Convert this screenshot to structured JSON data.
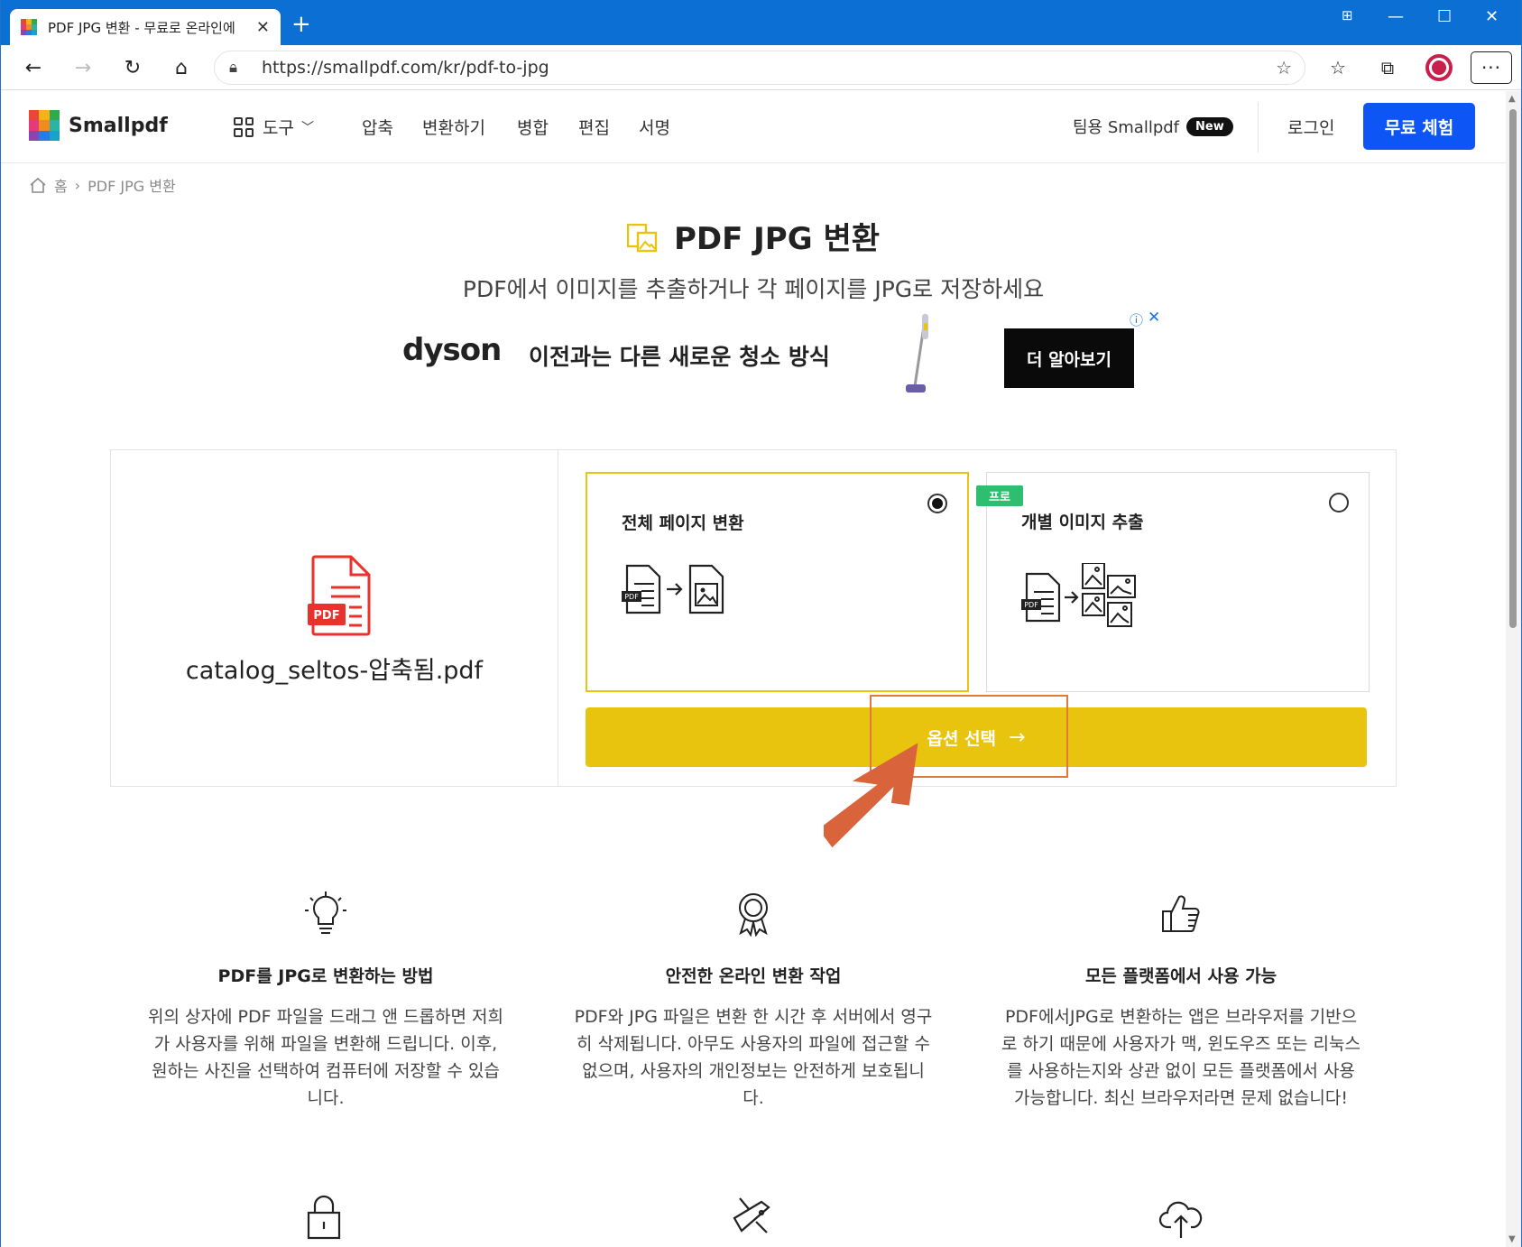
{
  "browser": {
    "tab_title": "PDF JPG 변환 - 무료로 온라인에",
    "url": "https://smallpdf.com/kr/pdf-to-jpg"
  },
  "header": {
    "logo_text": "Smallpdf",
    "tools_label": "도구",
    "nav": [
      "압축",
      "변환하기",
      "병합",
      "편집",
      "서명"
    ],
    "team_label": "팀용 Smallpdf",
    "team_badge": "New",
    "login_label": "로그인",
    "trial_label": "무료 체험"
  },
  "breadcrumb": {
    "home": "홈",
    "separator": "›",
    "current": "PDF JPG 변환"
  },
  "hero": {
    "title": "PDF JPG 변환",
    "subtitle": "PDF에서 이미지를 추출하거나 각 페이지를 JPG로 저장하세요"
  },
  "ad": {
    "brand": "dyson",
    "slogan": "이전과는 다른 새로운 청소 방식",
    "cta": "더 알아보기",
    "info_icon": "ⓘ",
    "close_icon": "✕"
  },
  "converter": {
    "filename": "catalog_seltos-압축됨.pdf",
    "file_badge": "PDF",
    "options": [
      {
        "label": "전체 페이지 변환",
        "selected": true
      },
      {
        "label": "개별 이미지 추출",
        "selected": false,
        "badge": "프로"
      }
    ],
    "icon_pdf_tag": "PDF",
    "submit_label": "옵션 선택",
    "submit_arrow": "→",
    "accent_color": "#e8c40f",
    "annotation_color": "#e07a3a"
  },
  "features": [
    {
      "icon": "lightbulb-icon",
      "title": "PDF를 JPG로 변환하는 방법",
      "text": "위의 상자에 PDF 파일을 드래그 앤 드롭하면 저희가 사용자를 위해 파일을 변환해 드립니다. 이후, 원하는 사진을 선택하여 컴퓨터에 저장할 수 있습니다."
    },
    {
      "icon": "award-icon",
      "title": "안전한 온라인 변환 작업",
      "text": "PDF와 JPG 파일은 변환 한 시간 후 서버에서 영구히 삭제됩니다. 아무도 사용자의 파일에 접근할 수 없으며, 사용자의 개인정보는 안전하게 보호됩니다."
    },
    {
      "icon": "thumbs-up-icon",
      "title": "모든 플랫폼에서 사용 가능",
      "text": "PDF에서JPG로 변환하는 앱은 브라우저를 기반으로 하기 때문에 사용자가 맥, 윈도우즈 또는 리눅스를 사용하는지와 상관 없이 모든 플랫폼에서 사용 가능합니다. 최신 브라우저라면 문제 없습니다!"
    }
  ]
}
